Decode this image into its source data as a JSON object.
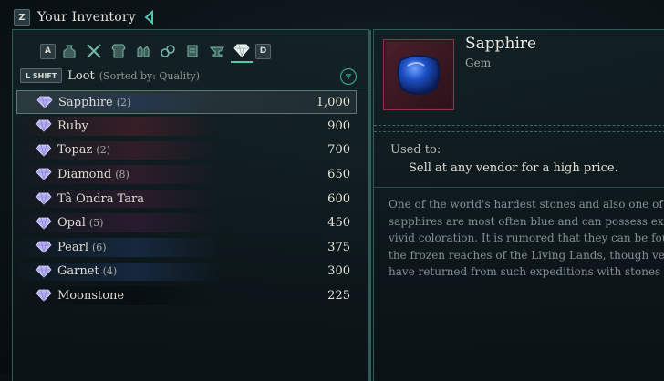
{
  "header": {
    "key": "Z",
    "title": "Your Inventory"
  },
  "tabs": {
    "prev_key": "A",
    "next_key": "D",
    "icons": [
      "potion-bag-icon",
      "crossed-swords-icon",
      "armor-icon",
      "hands-icon",
      "rings-icon",
      "scroll-icon",
      "anvil-icon",
      "gem-icon"
    ],
    "active_index": 7
  },
  "loot": {
    "shift_key": "L SHIFT",
    "label": "Loot",
    "sorted": "(Sorted by: Quality)"
  },
  "items": [
    {
      "name": "Sapphire",
      "count": "(2)",
      "value": "1,000",
      "color": "40,60,120",
      "selected": true
    },
    {
      "name": "Ruby",
      "count": "",
      "value": "900",
      "color": "130,30,50"
    },
    {
      "name": "Topaz",
      "count": "(2)",
      "value": "700",
      "color": "110,30,60"
    },
    {
      "name": "Diamond",
      "count": "(8)",
      "value": "650",
      "color": "100,30,60"
    },
    {
      "name": "Tâ Ondra Tara",
      "count": "",
      "value": "600",
      "color": "95,30,70"
    },
    {
      "name": "Opal",
      "count": "(5)",
      "value": "450",
      "color": "90,30,80"
    },
    {
      "name": "Pearl",
      "count": "(6)",
      "value": "375",
      "color": "40,70,130"
    },
    {
      "name": "Garnet",
      "count": "(4)",
      "value": "300",
      "color": "40,70,130"
    },
    {
      "name": "Moonstone",
      "count": "",
      "value": "225",
      "color": "0,0,0"
    }
  ],
  "detail": {
    "name": "Sapphire",
    "type": "Gem",
    "used_label": "Used to:",
    "used_text": "Sell at any vendor for a high price.",
    "description_lines": [
      "One of the world's hardest stones and also one of",
      "sapphires are most often blue and can possess extr",
      "vivid coloration. It is rumored that they can be fou",
      "the frozen reaches of the Living Lands, though ve",
      "have returned from such expeditions with stones t"
    ]
  },
  "colors": {
    "accent": "#4ec9b0",
    "panel_border": "#2e5b55",
    "gem_fill": "#b7b2f5"
  }
}
